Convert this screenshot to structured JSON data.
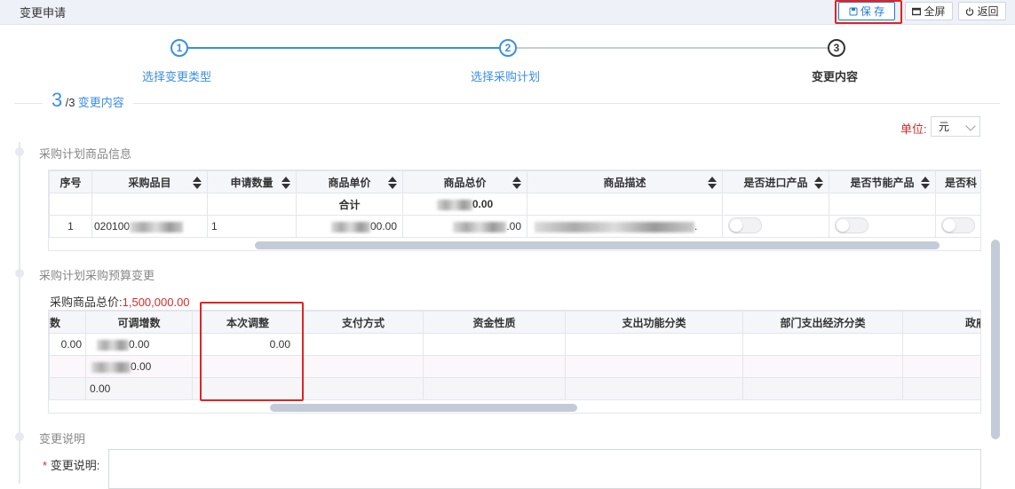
{
  "header": {
    "title": "变更申请",
    "save_label": "保 存",
    "fullscreen_label": "全屏",
    "back_label": "返回"
  },
  "steps": [
    {
      "num": "1",
      "label": "选择变更类型"
    },
    {
      "num": "2",
      "label": "选择采购计划"
    },
    {
      "num": "3",
      "label": "变更内容"
    }
  ],
  "section": {
    "current": "3",
    "total": "/3",
    "name": "变更内容"
  },
  "unit": {
    "label": "单位:",
    "value": "元"
  },
  "goods": {
    "title": "采购计划商品信息",
    "columns": [
      "序号",
      "采购品目",
      "申请数量",
      "商品单价",
      "商品总价",
      "商品描述",
      "是否进口产品",
      "是否节能产品",
      "是否科"
    ],
    "total_row": {
      "label": "合计",
      "total_suffix": "0.00"
    },
    "rows": [
      {
        "index": "1",
        "item_prefix": "020100",
        "qty": "1",
        "unit_price_suffix": "00.00",
        "total_suffix": ".00",
        "desc_suffix": "."
      }
    ]
  },
  "budget": {
    "title": "采购计划采购预算变更",
    "total_label": "采购商品总价:",
    "total_value": "1,500,000.00",
    "columns": [
      "数",
      "可调增数",
      "本次调整",
      "支付方式",
      "资金性质",
      "支出功能分类",
      "部门支出经济分类",
      "政府支出"
    ],
    "rows": [
      {
        "c0": "0.00",
        "c1_suffix": "0.00",
        "adjust": "0.00"
      },
      {
        "c0": "",
        "c1_suffix": "0.00",
        "adjust": ""
      },
      {
        "c0": "",
        "c1": "0.00",
        "adjust": ""
      }
    ]
  },
  "change_desc": {
    "title": "变更说明",
    "required_mark": "*",
    "label": "变更说明:"
  }
}
